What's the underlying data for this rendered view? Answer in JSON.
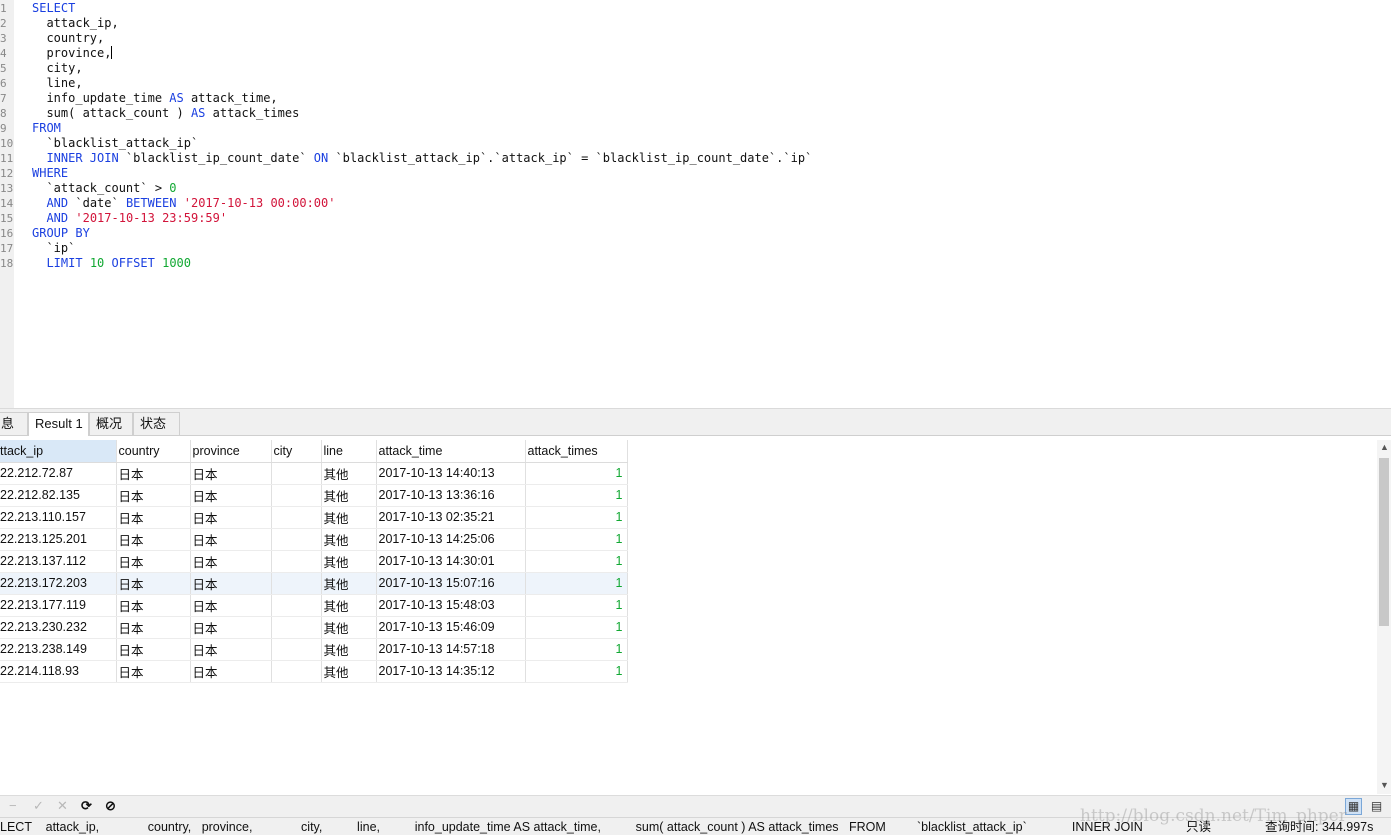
{
  "editor": {
    "line_numbers": [
      "1",
      "2",
      "3",
      "4",
      "5",
      "6",
      "7",
      "8",
      "9",
      "10",
      "11",
      "12",
      "13",
      "14",
      "15",
      "16",
      "17",
      "18"
    ],
    "lines": [
      [
        {
          "t": "SELECT",
          "c": "kw"
        }
      ],
      [
        {
          "t": "  attack_ip,",
          "c": ""
        }
      ],
      [
        {
          "t": "  country,",
          "c": ""
        }
      ],
      [
        {
          "t": "  province,",
          "c": ""
        }
      ],
      [
        {
          "t": "  city,",
          "c": ""
        }
      ],
      [
        {
          "t": "  line,",
          "c": ""
        }
      ],
      [
        {
          "t": "  info_update_time ",
          "c": ""
        },
        {
          "t": "AS",
          "c": "kw"
        },
        {
          "t": " attack_time,",
          "c": ""
        }
      ],
      [
        {
          "t": "  sum( attack_count ) ",
          "c": ""
        },
        {
          "t": "AS",
          "c": "kw"
        },
        {
          "t": " attack_times",
          "c": ""
        }
      ],
      [
        {
          "t": "FROM",
          "c": "kw"
        }
      ],
      [
        {
          "t": "  `blacklist_attack_ip`",
          "c": ""
        }
      ],
      [
        {
          "t": "  ",
          "c": ""
        },
        {
          "t": "INNER JOIN",
          "c": "kw"
        },
        {
          "t": " `blacklist_ip_count_date` ",
          "c": ""
        },
        {
          "t": "ON",
          "c": "kw"
        },
        {
          "t": " `blacklist_attack_ip`.`attack_ip` = `blacklist_ip_count_date`.`ip`",
          "c": ""
        }
      ],
      [
        {
          "t": "WHERE",
          "c": "kw"
        }
      ],
      [
        {
          "t": "  `attack_count` > ",
          "c": ""
        },
        {
          "t": "0",
          "c": "num"
        }
      ],
      [
        {
          "t": "  ",
          "c": ""
        },
        {
          "t": "AND",
          "c": "kw"
        },
        {
          "t": " `date` ",
          "c": ""
        },
        {
          "t": "BETWEEN",
          "c": "kw"
        },
        {
          "t": " ",
          "c": ""
        },
        {
          "t": "'2017-10-13 00:00:00'",
          "c": "str"
        }
      ],
      [
        {
          "t": "  ",
          "c": ""
        },
        {
          "t": "AND",
          "c": "kw"
        },
        {
          "t": " ",
          "c": ""
        },
        {
          "t": "'2017-10-13 23:59:59'",
          "c": "str"
        }
      ],
      [
        {
          "t": "GROUP BY",
          "c": "kw"
        }
      ],
      [
        {
          "t": "  `ip`",
          "c": ""
        }
      ],
      [
        {
          "t": "  ",
          "c": ""
        },
        {
          "t": "LIMIT",
          "c": "kw"
        },
        {
          "t": " ",
          "c": ""
        },
        {
          "t": "10",
          "c": "num"
        },
        {
          "t": " ",
          "c": ""
        },
        {
          "t": "OFFSET",
          "c": "kw"
        },
        {
          "t": " ",
          "c": ""
        },
        {
          "t": "1000",
          "c": "num"
        }
      ]
    ]
  },
  "tabs": [
    {
      "label": "息",
      "active": false
    },
    {
      "label": "Result 1",
      "active": true
    },
    {
      "label": "概况",
      "active": false
    },
    {
      "label": "状态",
      "active": false
    }
  ],
  "grid": {
    "columns": [
      "ttack_ip",
      "country",
      "province",
      "city",
      "line",
      "attack_time",
      "attack_times"
    ],
    "rows": [
      [
        "22.212.72.87",
        "日本",
        "日本",
        "",
        "其他",
        "2017-10-13 14:40:13",
        "1"
      ],
      [
        "22.212.82.135",
        "日本",
        "日本",
        "",
        "其他",
        "2017-10-13 13:36:16",
        "1"
      ],
      [
        "22.213.110.157",
        "日本",
        "日本",
        "",
        "其他",
        "2017-10-13 02:35:21",
        "1"
      ],
      [
        "22.213.125.201",
        "日本",
        "日本",
        "",
        "其他",
        "2017-10-13 14:25:06",
        "1"
      ],
      [
        "22.213.137.112",
        "日本",
        "日本",
        "",
        "其他",
        "2017-10-13 14:30:01",
        "1"
      ],
      [
        "22.213.172.203",
        "日本",
        "日本",
        "",
        "其他",
        "2017-10-13 15:07:16",
        "1"
      ],
      [
        "22.213.177.119",
        "日本",
        "日本",
        "",
        "其他",
        "2017-10-13 15:48:03",
        "1"
      ],
      [
        "22.213.230.232",
        "日本",
        "日本",
        "",
        "其他",
        "2017-10-13 15:46:09",
        "1"
      ],
      [
        "22.213.238.149",
        "日本",
        "日本",
        "",
        "其他",
        "2017-10-13 14:57:18",
        "1"
      ],
      [
        "22.214.118.93",
        "日本",
        "日本",
        "",
        "其他",
        "2017-10-13 14:35:12",
        "1"
      ]
    ]
  },
  "toolbar": {
    "minus": "−",
    "check": "✓",
    "cross": "✕",
    "refresh": "⟳",
    "stop": "⊘",
    "grid_view": "▦",
    "form_view": "▤"
  },
  "status": {
    "sql": "LECT    attack_ip,              country,   province,              city,          line,          info_update_time AS attack_time,          sum( attack_count ) AS attack_times   FROM         `blacklist_attack_ip`             INNER JOIN",
    "readonly": "只读",
    "query_time": "查询时间: 344.997s"
  },
  "watermark": "http://blog.csdn.net/Tim_phper"
}
